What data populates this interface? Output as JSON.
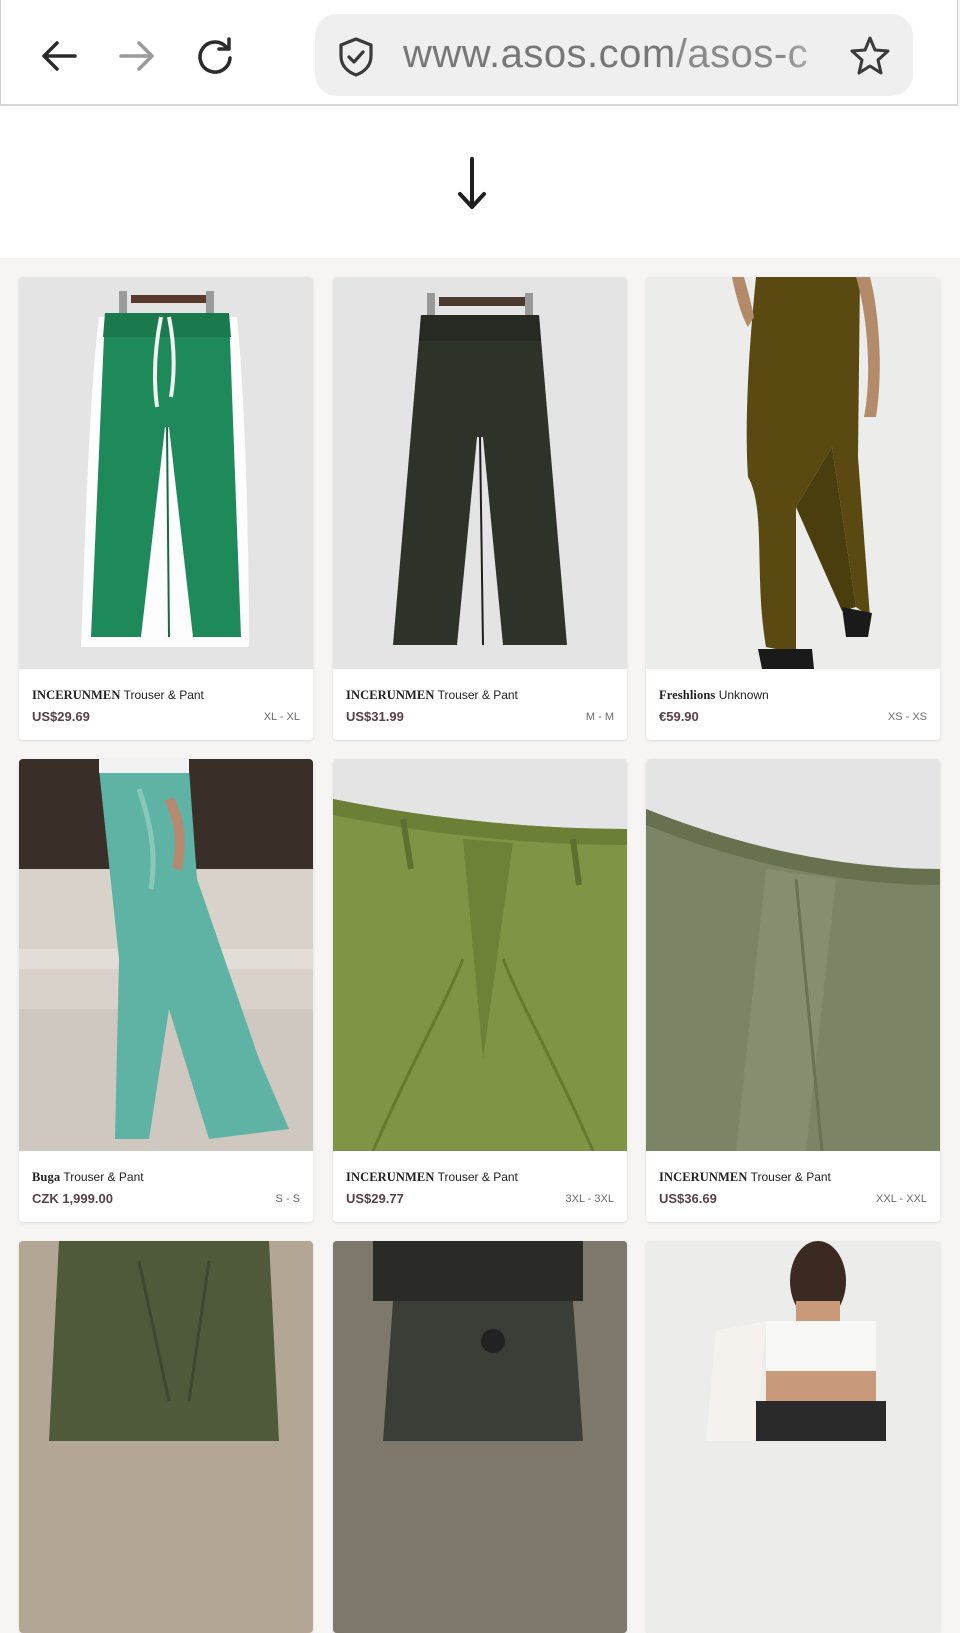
{
  "browser": {
    "url_host": "www.asos.com",
    "url_path": "/asos-c"
  },
  "products": [
    {
      "brand": "INCERUNMEN",
      "type": "Trouser & Pant",
      "price": "US$29.69",
      "size": "XL - XL"
    },
    {
      "brand": "INCERUNMEN",
      "type": "Trouser & Pant",
      "price": "US$31.99",
      "size": "M - M"
    },
    {
      "brand": "Freshlions",
      "type": "Unknown",
      "price": "€59.90",
      "size": "XS - XS"
    },
    {
      "brand": "Buga",
      "type": "Trouser & Pant",
      "price": "CZK 1,999.00",
      "size": "S - S"
    },
    {
      "brand": "INCERUNMEN",
      "type": "Trouser & Pant",
      "price": "US$29.77",
      "size": "3XL - 3XL"
    },
    {
      "brand": "INCERUNMEN",
      "type": "Trouser & Pant",
      "price": "US$36.69",
      "size": "XXL - XXL"
    }
  ],
  "icons": {
    "back": "arrow-left-icon",
    "forward": "arrow-right-icon",
    "reload": "reload-icon",
    "secure": "shield-check-icon",
    "bookmark": "star-icon",
    "scroll": "arrow-down-icon"
  }
}
